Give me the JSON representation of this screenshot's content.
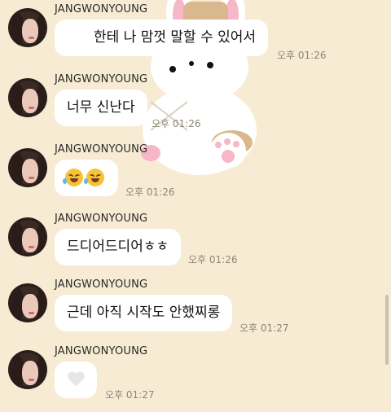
{
  "colors": {
    "background": "#f7ecd3",
    "bubble": "#ffffff",
    "time_text": "#8b8577"
  },
  "messages": [
    {
      "sender": "JANGWONYOUNG",
      "text": "한테 나 맘껏 말할 수 있어서",
      "time": "오후 01:26"
    },
    {
      "sender": "JANGWONYOUNG",
      "text": "너무 신난다",
      "time": "오후 01:26"
    },
    {
      "sender": "JANGWONYOUNG",
      "emojis": [
        "rolling-on-floor-laughing-emoji",
        "rolling-on-floor-laughing-emoji"
      ],
      "time": "오후 01:26"
    },
    {
      "sender": "JANGWONYOUNG",
      "text": "드디어드디어ㅎㅎ",
      "time": "오후 01:26"
    },
    {
      "sender": "JANGWONYOUNG",
      "text": "근데 아직 시작도 안했찌롱",
      "time": "오후 01:27"
    },
    {
      "sender": "JANGWONYOUNG",
      "emojis": [
        "white-heart-emoji"
      ],
      "time": "오후 01:27"
    }
  ]
}
